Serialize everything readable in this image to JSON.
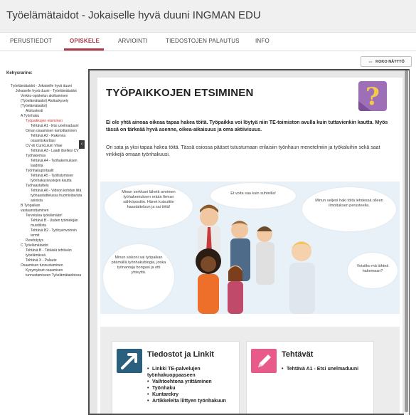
{
  "header": {
    "title": "Työelämätaidot - Jokaiselle hyvä duuni INGMAN EDU"
  },
  "tabs": [
    {
      "label": "PERUSTIEDOT"
    },
    {
      "label": "OPISKELE"
    },
    {
      "label": "ARVIOINTI"
    },
    {
      "label": "TIEDOSTOJEN PALAUTUS"
    },
    {
      "label": "INFO"
    }
  ],
  "toolbar": {
    "fullscreen_label": "KOKO NÄYTTÖ"
  },
  "sidebar": {
    "title": "Kehysrarine:",
    "toc": [
      {
        "text": "Työelämätaidot - Jokaiselle hyvä duuni"
      },
      {
        "text": "Jokaiselle hyvä duuni - Työelämätaidot"
      },
      {
        "text": "Verkko-opiskelun aloittaminen"
      },
      {
        "text": "(Työelämätaidot) Aloituskysely (Työelämätaidot)"
      },
      {
        "text": "Aloitustesti"
      },
      {
        "text": "A Työnhaku"
      },
      {
        "text": "Työpaikkojen etsiminen"
      },
      {
        "text": "Tehtävä A1 - Etsi unelmaduuni"
      },
      {
        "text": "Oman osaamisen kartoittaminen"
      },
      {
        "text": "Tehtävä A2 - Rakenna osaamiskarttasi"
      },
      {
        "text": "CV eli Curriculum Vitae"
      },
      {
        "text": "Tehtävä A3 - Laadi itsellesi CV"
      },
      {
        "text": "Työhakemus"
      },
      {
        "text": "Tehtävä A4 - Työhakemuksen laadinta"
      },
      {
        "text": "Työnhakuportaalit"
      },
      {
        "text": "Tehtävä A5 - Työllistymisen työnhakusivustojen kautta"
      },
      {
        "text": "Työhaastattelu"
      },
      {
        "text": "Tehtävä A6 - Videon kohdan liitä työhaastattelussa huomioitavista asioista"
      },
      {
        "text": "B Työpaikan"
      },
      {
        "text": "vastaanottaminen"
      },
      {
        "text": "Tervetuloa työelämään!"
      },
      {
        "text": "Tehtävä B - Uuden työntekijän muistilista"
      },
      {
        "text": "Tehtävä B2 - Työhyvinvoinnin termit"
      },
      {
        "text": "Perehdytys"
      },
      {
        "text": "C Työelämätaidot"
      },
      {
        "text": "Tehtävä B - Tätäisiä tehtävän työelämässä"
      },
      {
        "text": "Tehtävä X - Palaute"
      },
      {
        "text": "Osaamisen tunnustaminen"
      },
      {
        "text": "Kysymykset osaamisen tunnustamiseen Työelämätaidoissa"
      }
    ]
  },
  "content": {
    "title": "TYÖPAIKKOJEN ETSIMINEN",
    "lead": "Ei ole yhtä ainoaa oikeaa tapaa hakea töitä. Työpaikka voi löytyä niin TE-toimiston avulla kuin tuttavienkin kautta. Myös tässä on tärkeää hyvä asenne, oikea-aikaisuus ja oma aktiivisuus.",
    "paragraph": "On sata ja yksi tapaa hakea töitä. Tässä osiossa pääset tutustumaan erilaisiin työnhaun menetelmiin ja työkaluihin sekä saat vinkkejä omaan työnhakuusi.",
    "bubbles": [
      "Minun serkkuni lähetti avoimen työhakemuksen erään firman sähköpostiin. Hänet kutsuttiin haastatteluun ja sai töitä!",
      "Et voita saa kuin suhteilla!",
      "Minun veljeni haki töitä lehdessä olleen ilmoituksen perusteella.",
      "Minun siskoni sai työpaikan pitämällä työnhakublogia, jonka työnantaja bongasi ja otti yhteyttä.",
      "Voisitko mä lähteä hakemaan?"
    ],
    "cards": [
      {
        "title": "Tiedostot ja Linkit",
        "items": [
          "Linkki TE-palvelujen työnhakuoppaaseen",
          "Vaihtoehtona yrittäminen",
          "Työnhaku",
          "Kuntarekry",
          "Artikkeleita liittyen työnhakuun"
        ]
      },
      {
        "title": "Tehtävät",
        "items": [
          "Tehtävä A1 - Etsi unelmaduuni"
        ]
      }
    ]
  },
  "colors": {
    "accent": "#a43b4a",
    "link_card_icon": "#2b5f7e",
    "task_card_icon": "#e75a8a",
    "illustration_bg": "#e8f1f7"
  },
  "icons": {
    "fullscreen": "expand-icon",
    "collapse": "chevron-left-icon",
    "question": "question-mark-icon",
    "link_card": "arrow-icon",
    "task_card": "pencil-icon"
  }
}
